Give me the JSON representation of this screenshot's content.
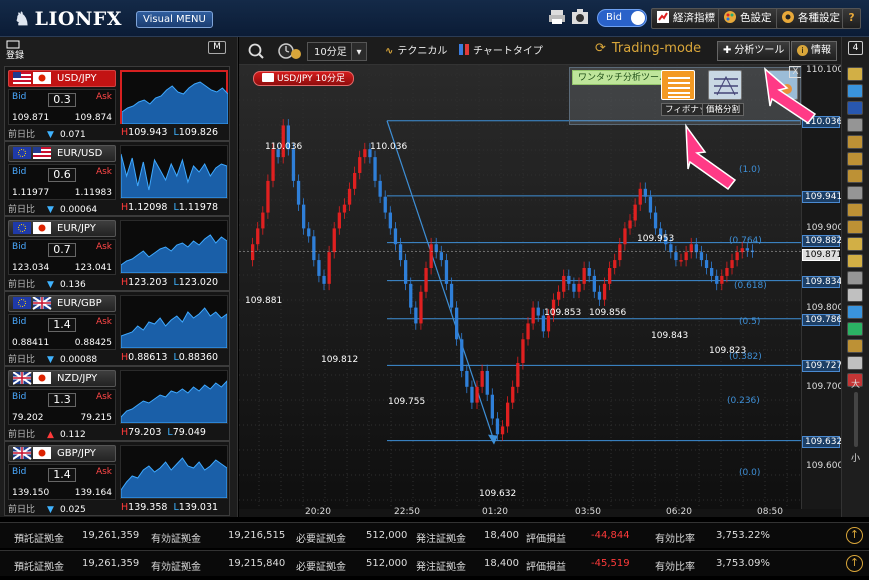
{
  "header": {
    "logo": "LIONFX",
    "visual_menu": "Visual MENU",
    "bid_toggle": "Bid",
    "economic_indicators": "経済指標",
    "color_settings": "色設定",
    "settings": "各種設定",
    "help": "?"
  },
  "left_panel": {
    "register_label": "登録",
    "m_label": "M",
    "pairs": [
      {
        "name": "USD/JPY",
        "spread": "0.3",
        "bid": "109.871",
        "ask": "109.874",
        "change_label": "前日比",
        "change": "0.071",
        "dir": "down",
        "high": "109.943",
        "low": "109.826",
        "selected": true
      },
      {
        "name": "EUR/USD",
        "spread": "0.6",
        "bid": "1.11977",
        "ask": "1.11983",
        "change_label": "前日比",
        "change": "0.00064",
        "dir": "down",
        "high": "1.12098",
        "low": "1.11978",
        "selected": false
      },
      {
        "name": "EUR/JPY",
        "spread": "0.7",
        "bid": "123.034",
        "ask": "123.041",
        "change_label": "前日比",
        "change": "0.136",
        "dir": "down",
        "high": "123.203",
        "low": "123.020",
        "selected": false
      },
      {
        "name": "EUR/GBP",
        "spread": "1.4",
        "bid": "0.88411",
        "ask": "0.88425",
        "change_label": "前日比",
        "change": "0.00088",
        "dir": "down",
        "high": "0.88613",
        "low": "0.88360",
        "selected": false
      },
      {
        "name": "NZD/JPY",
        "spread": "1.3",
        "bid": "79.202",
        "ask": "79.215",
        "change_label": "前日比",
        "change": "0.112",
        "dir": "up",
        "high": "79.203",
        "low": "79.049",
        "selected": false
      },
      {
        "name": "GBP/JPY",
        "spread": "1.4",
        "bid": "139.150",
        "ask": "139.164",
        "change_label": "前日比",
        "change": "0.025",
        "dir": "down",
        "high": "139.358",
        "low": "139.031",
        "selected": false
      }
    ]
  },
  "toolbar": {
    "timeframe": "10分足",
    "technical": "テクニカル",
    "chart_type": "チャートタイプ",
    "trading_mode": "Trading-mode",
    "analysis_tool": "分析ツール",
    "info": "情報",
    "right_badge": "4"
  },
  "chart": {
    "pair_label": "USD/JPY 10分足",
    "oneclick_label": "ワンタッチ分析ツール",
    "fibonacci_caption": "フィボナッチ",
    "price_split_caption": "価格分割",
    "close_x": "X",
    "price_annotations": [
      "110.036",
      "110.036",
      "109.881",
      "109.812",
      "109.755",
      "109.632",
      "109.853",
      "109.856",
      "109.953",
      "109.843",
      "109.823"
    ],
    "fib_levels": [
      "(1.0)",
      "(0.764)",
      "(0.618)",
      "(0.5)",
      "(0.382)",
      "(0.236)",
      "(0.0)"
    ],
    "y_labels": [
      "110.100",
      "110.036",
      "109.941",
      "109.900",
      "109.882",
      "109.871",
      "109.834",
      "109.800",
      "109.786",
      "109.727",
      "109.700",
      "109.632",
      "109.600"
    ],
    "x_labels": [
      "20:20",
      "22:50",
      "01:20",
      "03:50",
      "06:20",
      "08:50"
    ],
    "zoom_in": "大",
    "zoom_out": "小"
  },
  "footer_rows": [
    {
      "deposit_label": "預託証拠金",
      "deposit": "19,261,359",
      "effective_label": "有効証拠金",
      "effective": "19,216,515",
      "required_label": "必要証拠金",
      "required": "512,000",
      "order_label": "発注証拠金",
      "order": "18,400",
      "pl_label": "評価損益",
      "pl": "-44,844",
      "ratio_label": "有効比率",
      "ratio": "3,753.22%"
    },
    {
      "deposit_label": "預託証拠金",
      "deposit": "19,261,359",
      "effective_label": "有効証拠金",
      "effective": "19,215,840",
      "required_label": "必要証拠金",
      "required": "512,000",
      "order_label": "発注証拠金",
      "order": "18,400",
      "pl_label": "評価損益",
      "pl": "-45,519",
      "ratio_label": "有効比率",
      "ratio": "3,753.09%"
    }
  ],
  "colors": {
    "bull": "#e02020",
    "bear": "#2f7fd8",
    "fib": "#3e8fd6",
    "pink_arrow": "#ff3a86"
  }
}
